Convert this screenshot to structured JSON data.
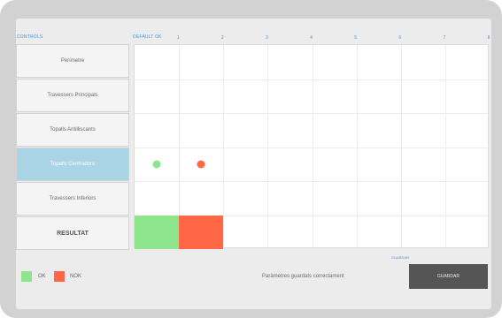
{
  "header": {
    "controls_label": "CONTROLS",
    "default_label": "DEFAULT OK",
    "columns": [
      "1",
      "2",
      "3",
      "4",
      "5",
      "6",
      "7",
      "8"
    ]
  },
  "sidebar": {
    "items": [
      {
        "label": "Perímetre",
        "active": false
      },
      {
        "label": "Travessers Principals",
        "active": false
      },
      {
        "label": "Topalls Antilliscants",
        "active": false
      },
      {
        "label": "Topalls Centradors",
        "active": true
      },
      {
        "label": "Travessers Inferiors",
        "active": false
      }
    ],
    "result_label": "RESULTAT"
  },
  "grid": {
    "rows": 6,
    "columns": 8,
    "markers": [
      {
        "row": 4,
        "column": 1,
        "status": "ok"
      },
      {
        "row": 4,
        "column": 2,
        "status": "nok"
      }
    ],
    "result_cells": [
      {
        "column": 1,
        "status": "ok"
      },
      {
        "column": 2,
        "status": "nok"
      }
    ]
  },
  "legend": {
    "ok_label": "OK",
    "nok_label": "NOK"
  },
  "status_message": "Paràmetres guardats correctament",
  "save_hint": "GUARDAR",
  "save_button_label": "GUARDAR",
  "colors": {
    "ok": "#8ee58e",
    "nok": "#ff6747",
    "active": "#a8d4e6",
    "accent": "#4a90d9",
    "button": "#555555"
  }
}
